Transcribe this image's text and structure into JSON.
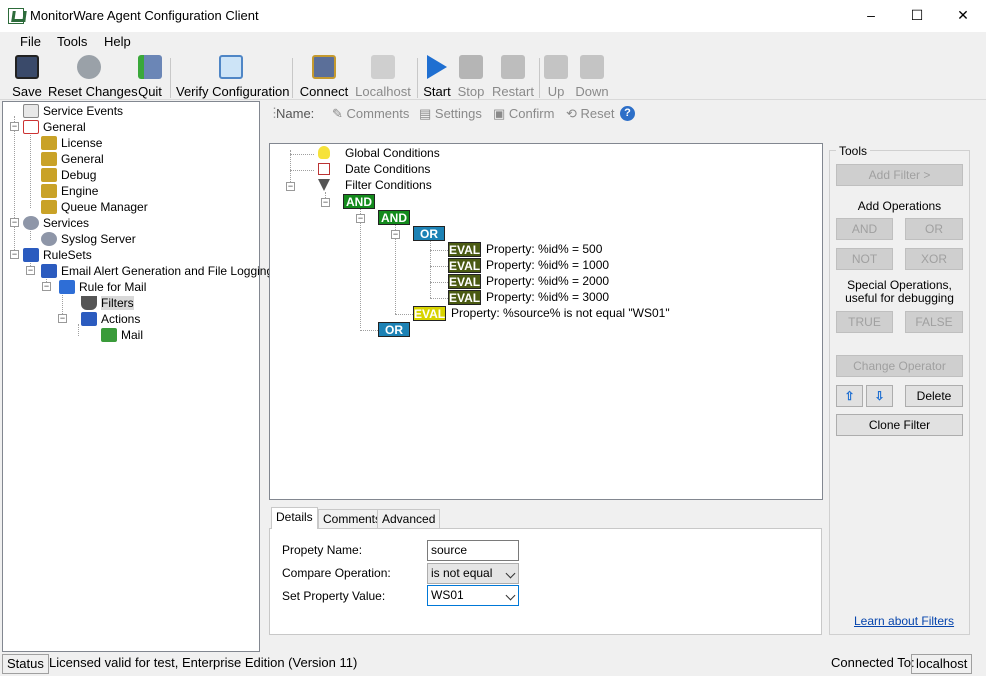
{
  "window": {
    "title": "MonitorWare Agent Configuration Client",
    "min": "–",
    "max": "☐",
    "close": "✕"
  },
  "menu": [
    "File",
    "Tools",
    "Help"
  ],
  "toolbar": {
    "save": "Save",
    "reset_changes": "Reset Changes",
    "quit": "Quit",
    "verify": "Verify Configuration",
    "connect": "Connect",
    "localhost": "Localhost",
    "start": "Start",
    "stop": "Stop",
    "restart": "Restart",
    "up": "Up",
    "down": "Down"
  },
  "tree": {
    "service_events": "Service Events",
    "general": "General",
    "license": "License",
    "general_child": "General",
    "debug": "Debug",
    "engine": "Engine",
    "queue_manager": "Queue Manager",
    "services": "Services",
    "syslog_server": "Syslog Server",
    "rulesets": "RuleSets",
    "email_alert": "Email Alert Generation and File Logging",
    "rule_for_mail": "Rule for Mail",
    "filters": "Filters",
    "actions": "Actions",
    "mail": "Mail"
  },
  "right_toolbar": {
    "name": "Name:",
    "comments": "Comments",
    "settings": "Settings",
    "confirm": "Confirm",
    "reset": "Reset"
  },
  "filter_tree": {
    "global_conditions": "Global Conditions",
    "date_conditions": "Date Conditions",
    "filter_conditions": "Filter Conditions",
    "and1": "AND",
    "and2": "AND",
    "or1": "OR",
    "or2": "OR",
    "eval": "EVAL",
    "evals": [
      "Property: %id% = 500",
      "Property: %id% = 1000",
      "Property: %id% = 2000",
      "Property: %id% = 3000"
    ],
    "eval_source": "Property: %source% is not equal \"WS01\""
  },
  "tools": {
    "title": "Tools",
    "add_filter": "Add Filter >",
    "add_operations": "Add Operations",
    "and": "AND",
    "or": "OR",
    "not": "NOT",
    "xor": "XOR",
    "special_1": "Special Operations,",
    "special_2": "useful for debugging",
    "true": "TRUE",
    "false": "FALSE",
    "change_operator": "Change Operator",
    "delete": "Delete",
    "clone_filter": "Clone Filter",
    "learn": "Learn about Filters"
  },
  "details": {
    "tabs": [
      "Details",
      "Comments",
      "Advanced"
    ],
    "property_name_label": "Propety Name:",
    "property_name_value": "source",
    "compare_label": "Compare Operation:",
    "compare_value": "is not equal",
    "set_value_label": "Set Property Value:",
    "set_value_value": "WS01"
  },
  "status": {
    "label": "Status",
    "license": "Licensed valid for test, Enterprise Edition (Version 11)",
    "connected_label": "Connected To:",
    "connected_value": "localhost"
  },
  "colors": {
    "and": "#138a1c",
    "or": "#1c82b5",
    "eval": "#4a5a12",
    "eval_selected": "#d8d400",
    "link": "#0645ad"
  }
}
